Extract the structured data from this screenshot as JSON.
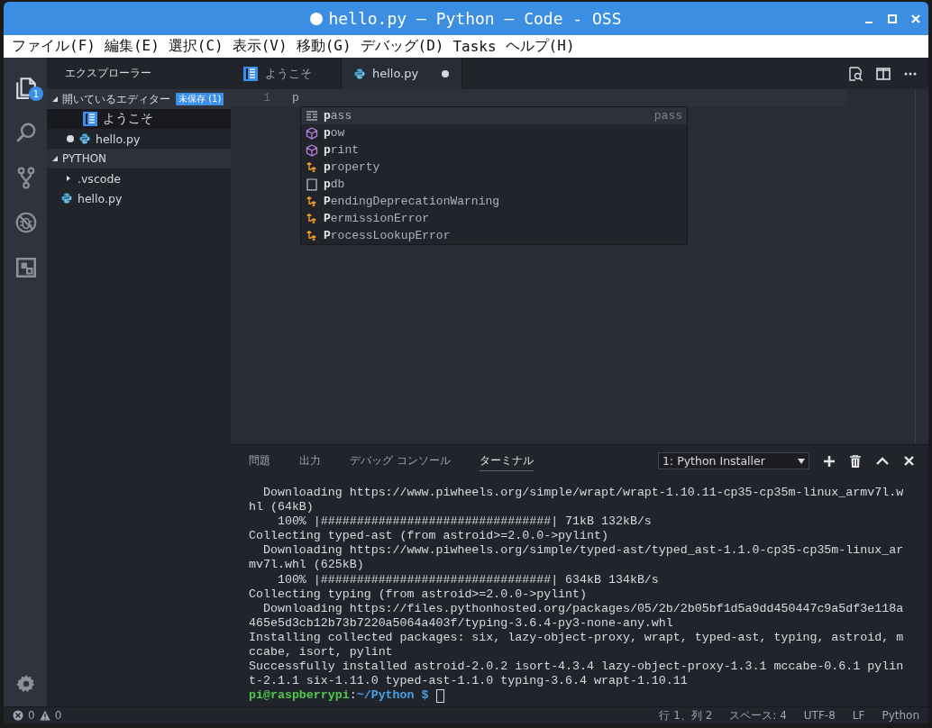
{
  "window": {
    "title": "hello.py — Python — Code - OSS",
    "dirty": true
  },
  "menu": [
    "ファイル(F)",
    "編集(E)",
    "選択(C)",
    "表示(V)",
    "移動(G)",
    "デバッグ(D)",
    "Tasks",
    "ヘルプ(H)"
  ],
  "activity_bar": [
    {
      "kind": "files",
      "selected": true,
      "badge": "1"
    },
    {
      "kind": "search",
      "selected": false
    },
    {
      "kind": "source-control",
      "selected": false
    },
    {
      "kind": "debug",
      "selected": false
    },
    {
      "kind": "extensions",
      "selected": false
    }
  ],
  "sidebar": {
    "title": "エクスプローラー",
    "sections": [
      {
        "title": "開いているエディター",
        "expanded": true,
        "badge": "未保存 (1)",
        "items": [
          {
            "label": "ようこそ",
            "kind": "welcome",
            "selected": true,
            "dirty": false
          },
          {
            "label": "hello.py",
            "kind": "python",
            "selected": false,
            "dirty": true
          }
        ]
      },
      {
        "title": "PYTHON",
        "expanded": true,
        "items": [
          {
            "label": ".vscode",
            "kind": "folder",
            "expanded": false,
            "selected": false
          },
          {
            "label": "hello.py",
            "kind": "python",
            "selected": false
          }
        ]
      }
    ]
  },
  "tabs": [
    {
      "label": "ようこそ",
      "kind": "welcome",
      "selected": false,
      "dirty": false
    },
    {
      "label": "hello.py",
      "kind": "python",
      "selected": true,
      "dirty": true
    }
  ],
  "editor": {
    "lines": [
      {
        "number": "1",
        "text": "p"
      }
    ],
    "suggestions": [
      {
        "label": "**p**ass",
        "kind": "snippet",
        "detail": "pass",
        "selected": true
      },
      {
        "label": "**p**ow",
        "kind": "function",
        "selected": false
      },
      {
        "label": "**p**rint",
        "kind": "function",
        "selected": false
      },
      {
        "label": "**p**roperty",
        "kind": "class",
        "selected": false
      },
      {
        "label": "**p**db",
        "kind": "module",
        "selected": false
      },
      {
        "label": "**P**endingDeprecationWarning",
        "kind": "class",
        "selected": false
      },
      {
        "label": "**P**ermissionError",
        "kind": "class",
        "selected": false
      },
      {
        "label": "**P**rocessLookupError",
        "kind": "class",
        "selected": false
      }
    ]
  },
  "panel": {
    "tabs": [
      {
        "label": "問題",
        "selected": false
      },
      {
        "label": "出力",
        "selected": false
      },
      {
        "label": "デバッグ コンソール",
        "selected": false
      },
      {
        "label": "ターミナル",
        "selected": true
      }
    ],
    "terminal_select": "1: Python Installer",
    "terminal_lines": [
      "  Downloading https://www.piwheels.org/simple/wrapt/wrapt-1.10.11-cp35-cp35m-linux_armv7l.w",
      "hl (64kB)",
      "    100% |################################| 71kB 132kB/s",
      "Collecting typed-ast (from astroid>=2.0.0->pylint)",
      "  Downloading https://www.piwheels.org/simple/typed-ast/typed_ast-1.1.0-cp35-cp35m-linux_ar",
      "mv7l.whl (625kB)",
      "    100% |################################| 634kB 134kB/s",
      "Collecting typing (from astroid>=2.0.0->pylint)",
      "  Downloading https://files.pythonhosted.org/packages/05/2b/2b05bf1d5a9dd450447c9a5df3e118a",
      "465e5d3cb12b73b7220a5064a403f/typing-3.6.4-py3-none-any.whl",
      "Installing collected packages: six, lazy-object-proxy, wrapt, typed-ast, typing, astroid, m",
      "ccabe, isort, pylint",
      "Successfully installed astroid-2.0.2 isort-4.3.4 lazy-object-proxy-1.3.1 mccabe-0.6.1 pylin",
      "t-2.1.1 six-1.11.0 typed-ast-1.1.0 typing-3.6.4 wrapt-1.10.11"
    ],
    "prompt": {
      "user": "pi@raspberrypi",
      "separator": ":",
      "path": "~/Python $"
    }
  },
  "status_bar": {
    "errors": "0",
    "warnings": "0",
    "right": [
      "行 1、列 2",
      "スペース: 4",
      "UTF-8",
      "LF",
      "Python"
    ]
  }
}
